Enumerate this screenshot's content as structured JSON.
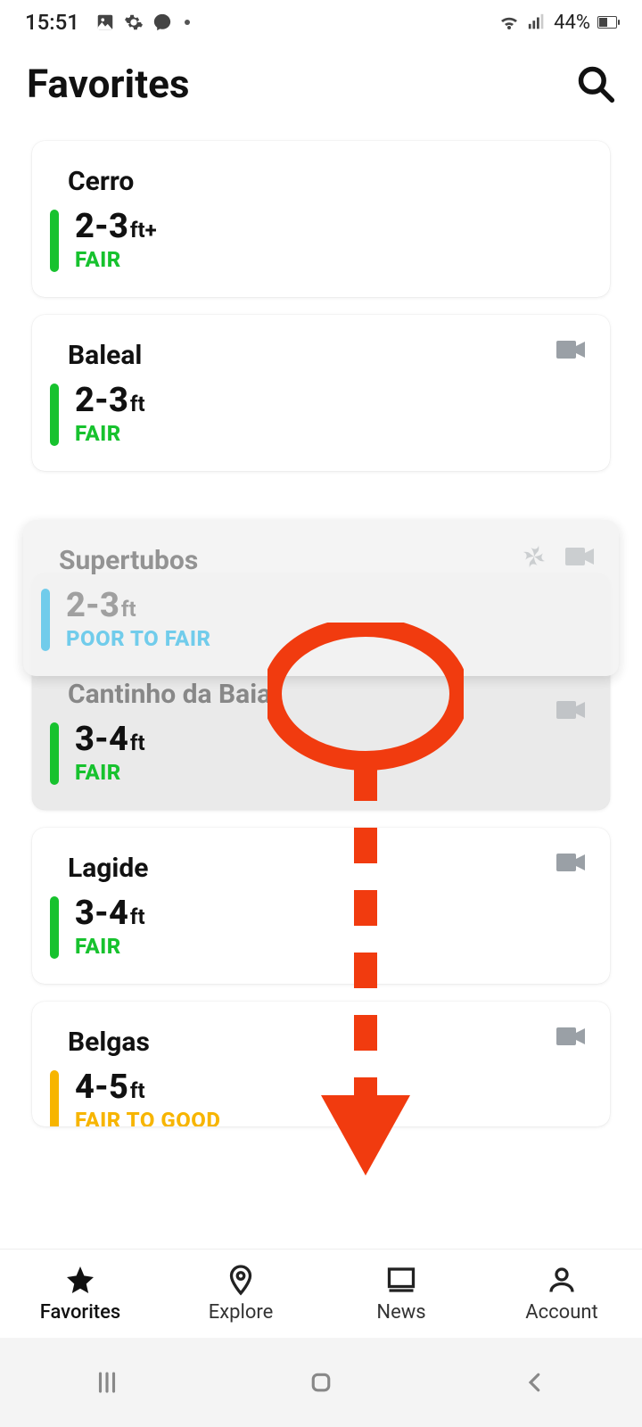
{
  "status": {
    "time": "15:51",
    "battery": "44%"
  },
  "header": {
    "title": "Favorites"
  },
  "spots": [
    {
      "name": "Cerro",
      "wave_height": "2-3",
      "unit": "ft+",
      "rating": "FAIR",
      "rating_color": "green",
      "bar_color": "green",
      "has_camera": false,
      "has_wind": false
    },
    {
      "name": "Baleal",
      "wave_height": "2-3",
      "unit": "ft",
      "rating": "FAIR",
      "rating_color": "green",
      "bar_color": "green",
      "has_camera": true,
      "has_wind": false
    }
  ],
  "dragged": {
    "floating": {
      "name": "Supertubos",
      "wave_height": "2-3",
      "unit": "ft",
      "rating": "POOR TO FAIR",
      "rating_color": "blue",
      "bar_color": "blue",
      "has_camera": true,
      "has_wind": true
    },
    "under": {
      "name": "Cantinho da Baia",
      "wave_height": "3-4",
      "unit": "ft",
      "rating": "FAIR",
      "rating_color": "green",
      "bar_color": "green",
      "has_camera": true,
      "has_wind": false
    }
  },
  "spots_after": [
    {
      "name": "Lagide",
      "wave_height": "3-4",
      "unit": "ft",
      "rating": "FAIR",
      "rating_color": "green",
      "bar_color": "green",
      "has_camera": true,
      "has_wind": false
    },
    {
      "name": "Belgas",
      "wave_height": "4-5",
      "unit": "ft",
      "rating": "FAIR TO GOOD",
      "rating_color": "yellow",
      "bar_color": "yellow",
      "has_camera": true,
      "has_wind": false
    }
  ],
  "nav": {
    "items": [
      {
        "label": "Favorites",
        "active": true
      },
      {
        "label": "Explore",
        "active": false
      },
      {
        "label": "News",
        "active": false
      },
      {
        "label": "Account",
        "active": false
      }
    ]
  }
}
